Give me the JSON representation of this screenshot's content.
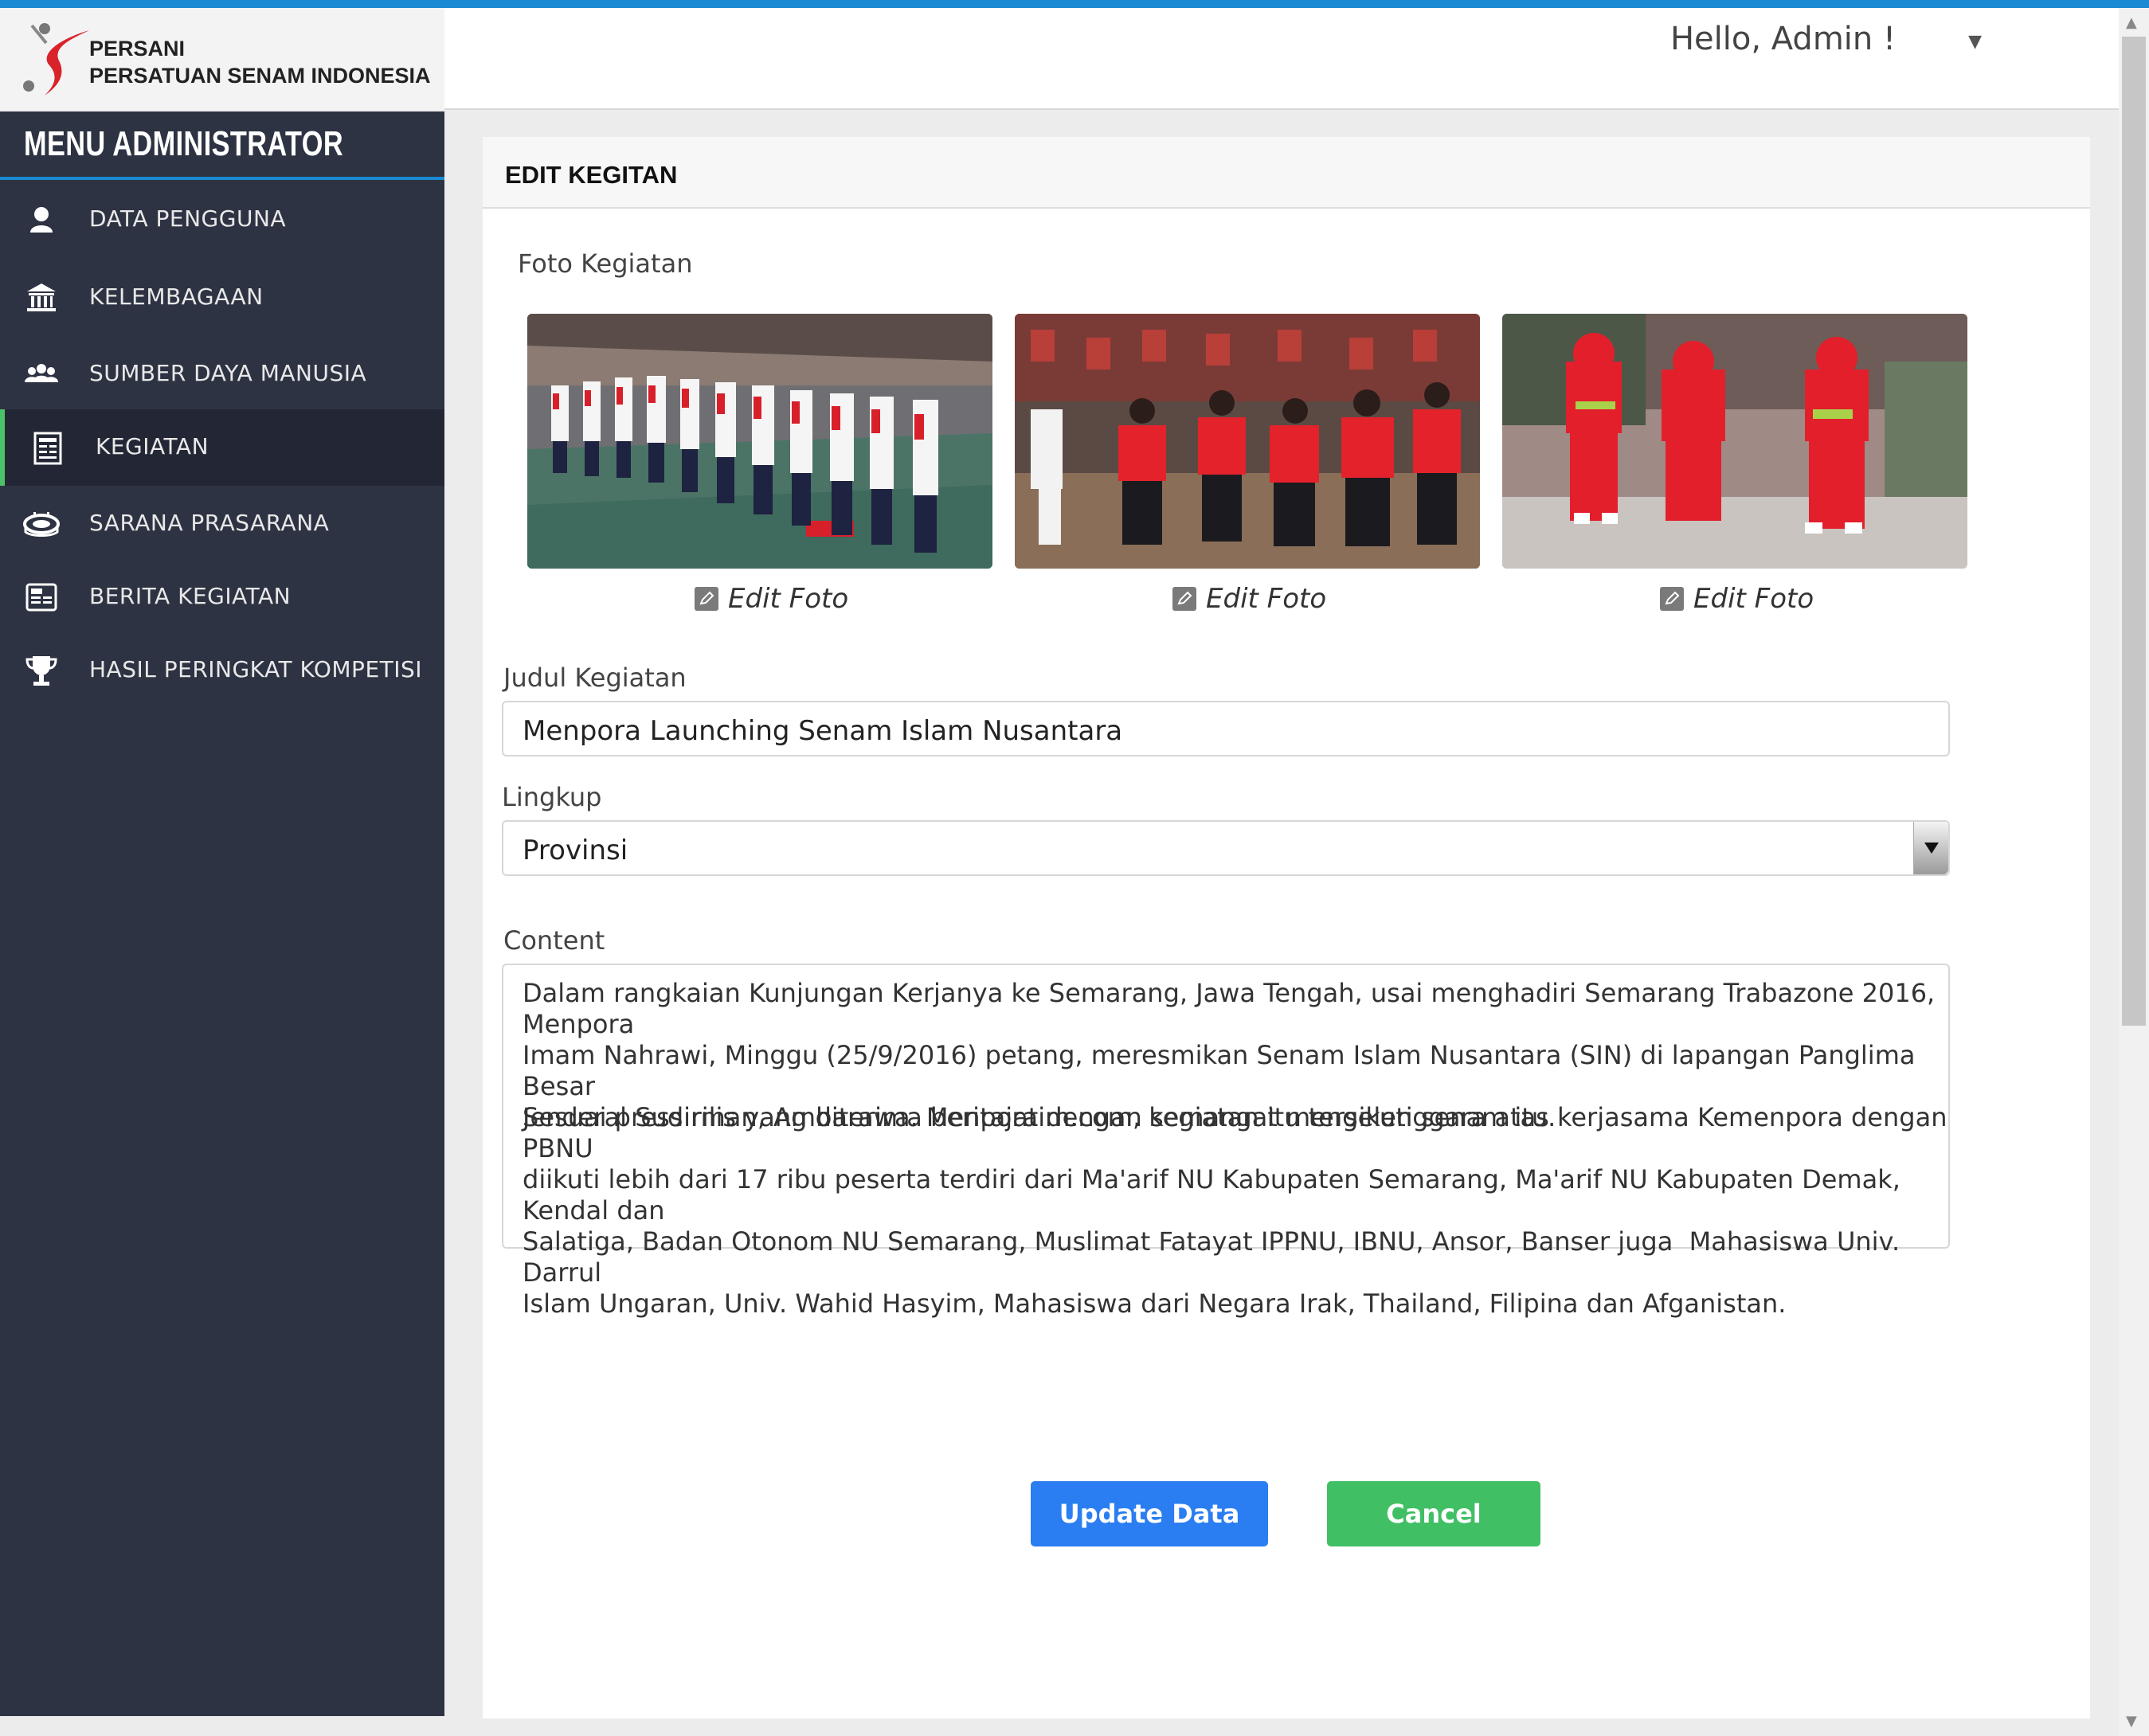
{
  "header": {
    "brand_short": "PERSANI",
    "brand_full": "PERSATUAN SENAM INDONESIA",
    "greeting": "Hello, Admin !"
  },
  "sidebar": {
    "title": "MENU ADMINISTRATOR",
    "items": [
      {
        "label": "DATA PENGGUNA",
        "icon": "user-icon"
      },
      {
        "label": "KELEMBAGAAN",
        "icon": "institution-icon"
      },
      {
        "label": "SUMBER DAYA MANUSIA",
        "icon": "people-icon"
      },
      {
        "label": "KEGIATAN",
        "icon": "activity-list-icon",
        "active": true
      },
      {
        "label": "SARANA PRASARANA",
        "icon": "stadium-icon"
      },
      {
        "label": "BERITA KEGIATAN",
        "icon": "news-icon"
      },
      {
        "label": "HASIL PERINGKAT KOMPETISI",
        "icon": "trophy-icon"
      }
    ]
  },
  "form": {
    "title": "EDIT KEGITAN",
    "photos_label": "Foto Kegiatan",
    "edit_photo_label": "Edit Foto",
    "title_label": "Judul Kegiatan",
    "title_value": "Menpora Launching Senam Islam Nusantara",
    "scope_label": "Lingkup",
    "scope_value": "Provinsi",
    "content_label": "Content",
    "content_p1": "Dalam rangkaian Kunjungan Kerjanya ke Semarang, Jawa Tengah, usai menghadiri Semarang Trabazone 2016, Menpora\nImam Nahrawi, Minggu (25/9/2016) petang, meresmikan Senam Islam Nusantara (SIN) di lapangan Panglima Besar\nJenderal Sudirman, Ambarawa. Menpora dengan semangat mengikuti senam itu.",
    "content_p2": "Sesuai press rilis yang diterima beritajatim.com, kegiatan itu terselenggara atas kerjasama Kemenpora dengan PBNU\ndiikuti lebih dari 17 ribu peserta terdiri dari Ma'arif NU Kabupaten Semarang, Ma'arif NU Kabupaten Demak, Kendal dan\nSalatiga, Badan Otonom NU Semarang, Muslimat Fatayat IPPNU, IBNU, Ansor, Banser juga  Mahasiswa Univ. Darrul\nIslam Ungaran, Univ. Wahid Hasyim, Mahasiswa dari Negara Irak, Thailand, Filipina dan Afganistan.",
    "update_button": "Update Data",
    "cancel_button": "Cancel"
  },
  "colors": {
    "accent": "#1a8ad4",
    "sidebar_bg": "#2e3343",
    "active_marker": "#4bc26a",
    "update_button": "#2a7ef2",
    "cancel_button": "#41bf64"
  }
}
